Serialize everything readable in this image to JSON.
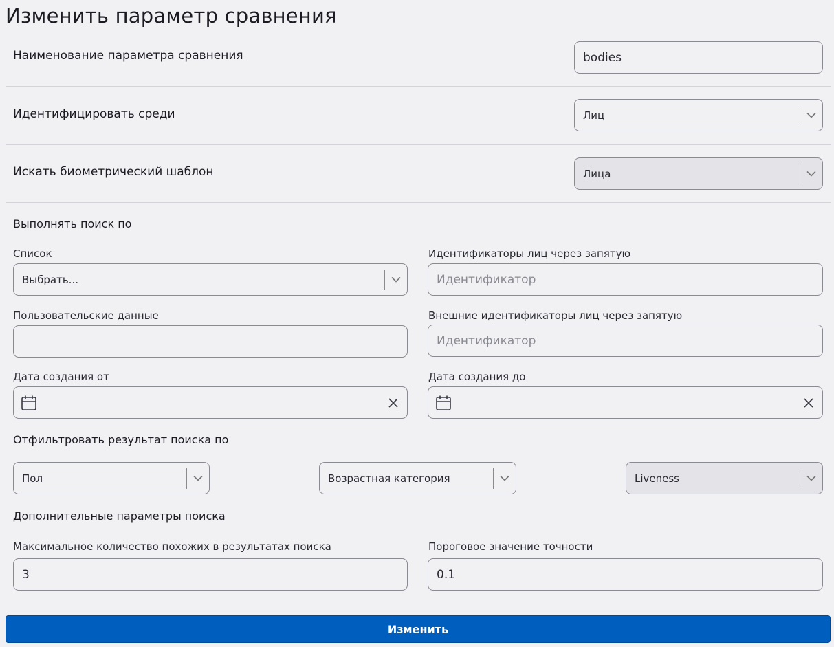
{
  "title": "Изменить параметр сравнения",
  "name_row": {
    "label": "Наименование параметра сравнения",
    "value": "bodies"
  },
  "identify_row": {
    "label": "Идентифицировать среди",
    "selected": "Лиц"
  },
  "template_row": {
    "label": "Искать биометрический шаблон",
    "selected": "Лица"
  },
  "search_section": {
    "heading": "Выполнять поиск по",
    "list": {
      "label": "Список",
      "placeholder": "Выбрать..."
    },
    "face_ids": {
      "label": "Идентификаторы лиц через запятую",
      "placeholder": "Идентификатор"
    },
    "user_data": {
      "label": "Пользовательские данные",
      "value": ""
    },
    "external_ids": {
      "label": "Внешние идентификаторы лиц через запятую",
      "placeholder": "Идентификатор"
    },
    "date_from": {
      "label": "Дата создания от",
      "value": ""
    },
    "date_to": {
      "label": "Дата создания до",
      "value": ""
    }
  },
  "filter_section": {
    "heading": "Отфильтровать результат поиска по",
    "gender": {
      "placeholder": "Пол"
    },
    "age": {
      "placeholder": "Возрастная категория"
    },
    "liveness": {
      "placeholder": "Liveness"
    }
  },
  "extra_section": {
    "heading": "Дополнительные параметры поиска",
    "max_similar": {
      "label": "Максимальное количество похожих в результатах поиска",
      "value": "3"
    },
    "threshold": {
      "label": "Пороговое значение точности",
      "value": "0.1"
    }
  },
  "submit_label": "Изменить",
  "colors": {
    "background": "#f1f1f4",
    "primary": "#005ebf",
    "border": "#8a8a93",
    "disabled": "#e4e3e8"
  },
  "icons": {
    "dropdown": "chevron-down-icon",
    "date": "calendar-icon",
    "clear": "close-icon"
  }
}
